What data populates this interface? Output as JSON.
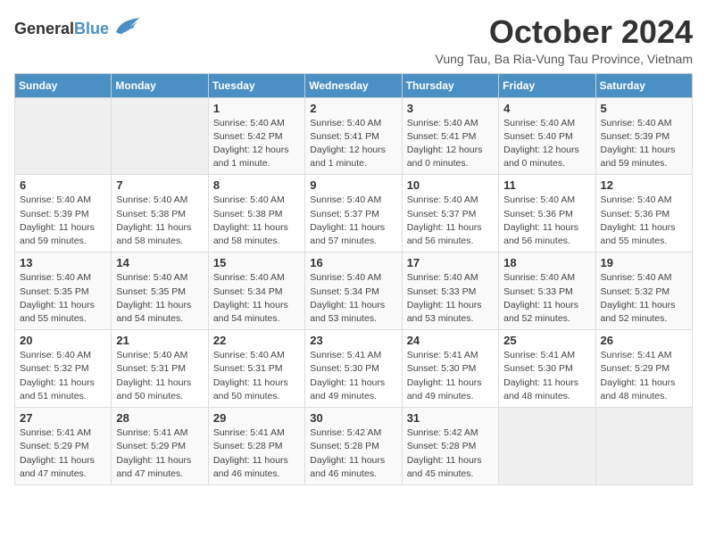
{
  "header": {
    "logo_general": "General",
    "logo_blue": "Blue",
    "month_title": "October 2024",
    "subtitle": "Vung Tau, Ba Ria-Vung Tau Province, Vietnam"
  },
  "columns": [
    "Sunday",
    "Monday",
    "Tuesday",
    "Wednesday",
    "Thursday",
    "Friday",
    "Saturday"
  ],
  "weeks": [
    [
      {
        "day": "",
        "empty": true
      },
      {
        "day": "",
        "empty": true
      },
      {
        "day": "1",
        "sunrise": "Sunrise: 5:40 AM",
        "sunset": "Sunset: 5:42 PM",
        "daylight": "Daylight: 12 hours and 1 minute."
      },
      {
        "day": "2",
        "sunrise": "Sunrise: 5:40 AM",
        "sunset": "Sunset: 5:41 PM",
        "daylight": "Daylight: 12 hours and 1 minute."
      },
      {
        "day": "3",
        "sunrise": "Sunrise: 5:40 AM",
        "sunset": "Sunset: 5:41 PM",
        "daylight": "Daylight: 12 hours and 0 minutes."
      },
      {
        "day": "4",
        "sunrise": "Sunrise: 5:40 AM",
        "sunset": "Sunset: 5:40 PM",
        "daylight": "Daylight: 12 hours and 0 minutes."
      },
      {
        "day": "5",
        "sunrise": "Sunrise: 5:40 AM",
        "sunset": "Sunset: 5:39 PM",
        "daylight": "Daylight: 11 hours and 59 minutes."
      }
    ],
    [
      {
        "day": "6",
        "sunrise": "Sunrise: 5:40 AM",
        "sunset": "Sunset: 5:39 PM",
        "daylight": "Daylight: 11 hours and 59 minutes."
      },
      {
        "day": "7",
        "sunrise": "Sunrise: 5:40 AM",
        "sunset": "Sunset: 5:38 PM",
        "daylight": "Daylight: 11 hours and 58 minutes."
      },
      {
        "day": "8",
        "sunrise": "Sunrise: 5:40 AM",
        "sunset": "Sunset: 5:38 PM",
        "daylight": "Daylight: 11 hours and 58 minutes."
      },
      {
        "day": "9",
        "sunrise": "Sunrise: 5:40 AM",
        "sunset": "Sunset: 5:37 PM",
        "daylight": "Daylight: 11 hours and 57 minutes."
      },
      {
        "day": "10",
        "sunrise": "Sunrise: 5:40 AM",
        "sunset": "Sunset: 5:37 PM",
        "daylight": "Daylight: 11 hours and 56 minutes."
      },
      {
        "day": "11",
        "sunrise": "Sunrise: 5:40 AM",
        "sunset": "Sunset: 5:36 PM",
        "daylight": "Daylight: 11 hours and 56 minutes."
      },
      {
        "day": "12",
        "sunrise": "Sunrise: 5:40 AM",
        "sunset": "Sunset: 5:36 PM",
        "daylight": "Daylight: 11 hours and 55 minutes."
      }
    ],
    [
      {
        "day": "13",
        "sunrise": "Sunrise: 5:40 AM",
        "sunset": "Sunset: 5:35 PM",
        "daylight": "Daylight: 11 hours and 55 minutes."
      },
      {
        "day": "14",
        "sunrise": "Sunrise: 5:40 AM",
        "sunset": "Sunset: 5:35 PM",
        "daylight": "Daylight: 11 hours and 54 minutes."
      },
      {
        "day": "15",
        "sunrise": "Sunrise: 5:40 AM",
        "sunset": "Sunset: 5:34 PM",
        "daylight": "Daylight: 11 hours and 54 minutes."
      },
      {
        "day": "16",
        "sunrise": "Sunrise: 5:40 AM",
        "sunset": "Sunset: 5:34 PM",
        "daylight": "Daylight: 11 hours and 53 minutes."
      },
      {
        "day": "17",
        "sunrise": "Sunrise: 5:40 AM",
        "sunset": "Sunset: 5:33 PM",
        "daylight": "Daylight: 11 hours and 53 minutes."
      },
      {
        "day": "18",
        "sunrise": "Sunrise: 5:40 AM",
        "sunset": "Sunset: 5:33 PM",
        "daylight": "Daylight: 11 hours and 52 minutes."
      },
      {
        "day": "19",
        "sunrise": "Sunrise: 5:40 AM",
        "sunset": "Sunset: 5:32 PM",
        "daylight": "Daylight: 11 hours and 52 minutes."
      }
    ],
    [
      {
        "day": "20",
        "sunrise": "Sunrise: 5:40 AM",
        "sunset": "Sunset: 5:32 PM",
        "daylight": "Daylight: 11 hours and 51 minutes."
      },
      {
        "day": "21",
        "sunrise": "Sunrise: 5:40 AM",
        "sunset": "Sunset: 5:31 PM",
        "daylight": "Daylight: 11 hours and 50 minutes."
      },
      {
        "day": "22",
        "sunrise": "Sunrise: 5:40 AM",
        "sunset": "Sunset: 5:31 PM",
        "daylight": "Daylight: 11 hours and 50 minutes."
      },
      {
        "day": "23",
        "sunrise": "Sunrise: 5:41 AM",
        "sunset": "Sunset: 5:30 PM",
        "daylight": "Daylight: 11 hours and 49 minutes."
      },
      {
        "day": "24",
        "sunrise": "Sunrise: 5:41 AM",
        "sunset": "Sunset: 5:30 PM",
        "daylight": "Daylight: 11 hours and 49 minutes."
      },
      {
        "day": "25",
        "sunrise": "Sunrise: 5:41 AM",
        "sunset": "Sunset: 5:30 PM",
        "daylight": "Daylight: 11 hours and 48 minutes."
      },
      {
        "day": "26",
        "sunrise": "Sunrise: 5:41 AM",
        "sunset": "Sunset: 5:29 PM",
        "daylight": "Daylight: 11 hours and 48 minutes."
      }
    ],
    [
      {
        "day": "27",
        "sunrise": "Sunrise: 5:41 AM",
        "sunset": "Sunset: 5:29 PM",
        "daylight": "Daylight: 11 hours and 47 minutes."
      },
      {
        "day": "28",
        "sunrise": "Sunrise: 5:41 AM",
        "sunset": "Sunset: 5:29 PM",
        "daylight": "Daylight: 11 hours and 47 minutes."
      },
      {
        "day": "29",
        "sunrise": "Sunrise: 5:41 AM",
        "sunset": "Sunset: 5:28 PM",
        "daylight": "Daylight: 11 hours and 46 minutes."
      },
      {
        "day": "30",
        "sunrise": "Sunrise: 5:42 AM",
        "sunset": "Sunset: 5:28 PM",
        "daylight": "Daylight: 11 hours and 46 minutes."
      },
      {
        "day": "31",
        "sunrise": "Sunrise: 5:42 AM",
        "sunset": "Sunset: 5:28 PM",
        "daylight": "Daylight: 11 hours and 45 minutes."
      },
      {
        "day": "",
        "empty": true
      },
      {
        "day": "",
        "empty": true
      }
    ]
  ]
}
